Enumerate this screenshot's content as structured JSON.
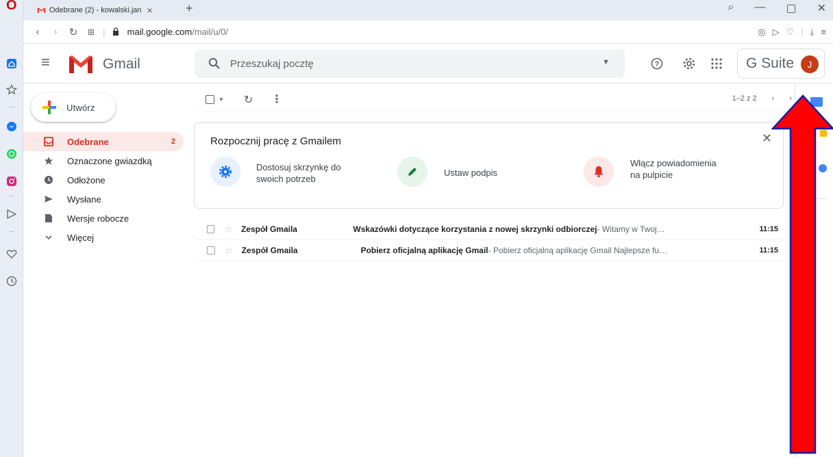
{
  "browser": {
    "tab_title": "Odebrane (2) - kowalski.jan",
    "tab_close": "×",
    "new_tab": "+",
    "url_domain": "mail.google.com",
    "url_path": "/mail/u/0/"
  },
  "header": {
    "app_name": "Gmail",
    "search_placeholder": "Przeszukaj pocztę",
    "gsuite_label": "G Suite",
    "avatar_initial": "J"
  },
  "compose": {
    "label": "Utwórz"
  },
  "nav": {
    "items": [
      {
        "label": "Odebrane",
        "count": "2"
      },
      {
        "label": "Oznaczone gwiazdką"
      },
      {
        "label": "Odłożone"
      },
      {
        "label": "Wysłane"
      },
      {
        "label": "Wersje robocze"
      },
      {
        "label": "Więcej"
      }
    ]
  },
  "toolbar": {
    "pager_text": "1–2 z 2"
  },
  "welcome": {
    "title": "Rozpocznij pracę z Gmailem",
    "tasks": [
      {
        "text": "Dostosuj skrzynkę do swoich potrzeb"
      },
      {
        "text": "Ustaw podpis"
      },
      {
        "text": "Włącz powiadomienia na pulpicie"
      }
    ]
  },
  "emails": [
    {
      "sender": "Zespół Gmaila",
      "subject": "Wskazówki dotyczące korzystania z nowej skrzynki odbiorczej",
      "snippet": " - Witamy w Twoj…",
      "time": "11:15"
    },
    {
      "sender": "Zespół Gmaila",
      "subject": "Pobierz oficjalną aplikację Gmail",
      "snippet": " - Pobierz oficjalną aplikację Gmail Najlepsze fu…",
      "time": "11:15"
    }
  ],
  "colors": {
    "accent_red": "#d93025",
    "arrow_red": "#ff0000",
    "arrow_outline": "#1a1aa6",
    "avatar_bg": "#c33d16"
  }
}
